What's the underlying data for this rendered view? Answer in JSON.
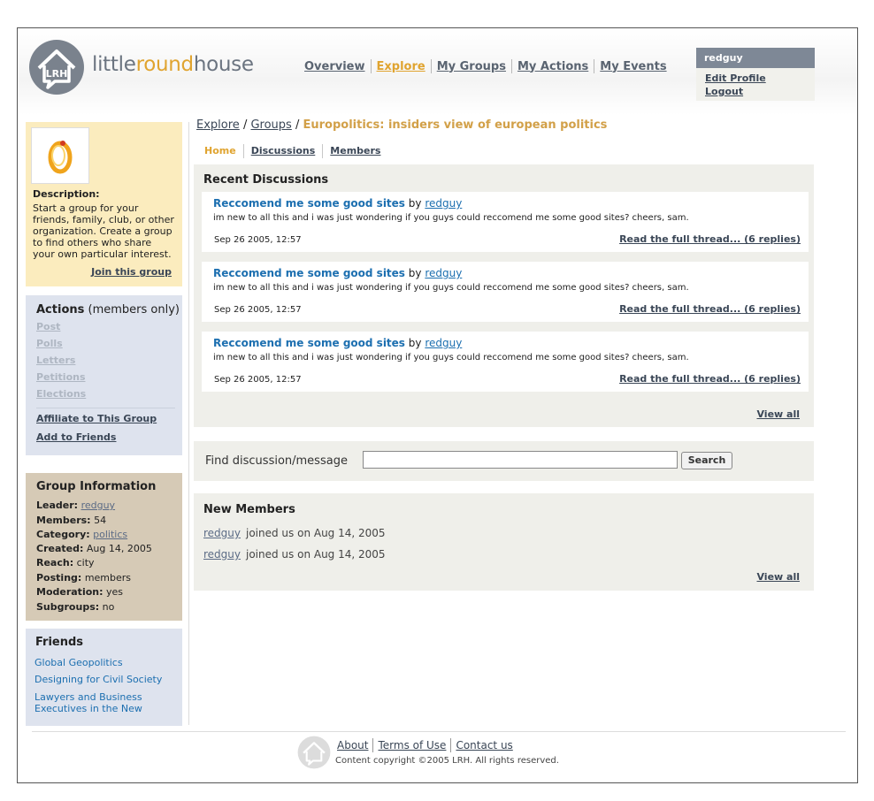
{
  "header": {
    "logo_icon_text": "LRH",
    "logo_part1": "little",
    "logo_part2": "round",
    "logo_part3": "house",
    "nav": [
      {
        "label": "Overview"
      },
      {
        "label": "Explore"
      },
      {
        "label": "My Groups"
      },
      {
        "label": "My Actions"
      },
      {
        "label": "My Events"
      }
    ],
    "user": {
      "name": "redguy",
      "edit_profile": "Edit Profile",
      "logout": "Logout"
    }
  },
  "sidebar": {
    "description_label": "Description:",
    "description_text": "Start a group for your friends, family, club, or other organization. Create a group to find others who share your own particular interest.",
    "join_link": "Join this group",
    "actions": {
      "title": "Actions",
      "subtitle": "(members only)",
      "items": [
        "Post",
        "Polls",
        "Letters",
        "Petitions",
        "Elections"
      ],
      "affiliate": "Affiliate to This Group",
      "add_friends": "Add to Friends"
    },
    "group_info": {
      "title": "Group Information",
      "leader_label": "Leader:",
      "leader": "redguy",
      "members_label": "Members:",
      "members": "54",
      "category_label": "Category:",
      "category": "politics",
      "created_label": "Created:",
      "created": "Aug 14, 2005",
      "reach_label": "Reach:",
      "reach": "city",
      "posting_label": "Posting:",
      "posting": "members",
      "moderation_label": "Moderation:",
      "moderation": "yes",
      "subgroups_label": "Subgroups:",
      "subgroups": "no"
    },
    "friends": {
      "title": "Friends",
      "items": [
        "Global Geopolitics",
        "Designing for Civil Society",
        "Lawyers and Business Executives in the New"
      ]
    }
  },
  "main": {
    "breadcrumb": {
      "explore": "Explore",
      "sep": "/",
      "groups": "Groups",
      "current": "Europolitics: insiders view of european politics"
    },
    "tabs": [
      {
        "label": "Home"
      },
      {
        "label": "Discussions"
      },
      {
        "label": "Members"
      }
    ],
    "recent": {
      "title": "Recent Discussions",
      "posts": [
        {
          "title": "Reccomend me some good sites",
          "by": "by",
          "user": "redguy",
          "body": "im new to all this and i was just wondering if you guys could reccomend me some good sites? cheers, sam.",
          "date": "Sep 26 2005, 12:57",
          "read": "Read the full thread... (6 replies)"
        },
        {
          "title": "Reccomend me some good sites",
          "by": "by",
          "user": "redguy",
          "body": "im new to all this and i was just wondering if you guys could reccomend me some good sites? cheers, sam.",
          "date": "Sep 26 2005, 12:57",
          "read": "Read the full thread... (6 replies)"
        },
        {
          "title": "Reccomend me some good sites",
          "by": "by",
          "user": "redguy",
          "body": "im new to all this and i was just wondering if you guys could reccomend me some good sites? cheers, sam.",
          "date": "Sep 26 2005, 12:57",
          "read": "Read the full thread... (6 replies)"
        }
      ],
      "view_all": "View all"
    },
    "find": {
      "label": "Find discussion/message",
      "value": "",
      "button": "Search"
    },
    "new_members": {
      "title": "New Members",
      "rows": [
        {
          "user": "redguy",
          "text": "joined us on Aug 14, 2005"
        },
        {
          "user": "redguy",
          "text": "joined us on Aug 14, 2005"
        }
      ],
      "view_all": "View all"
    }
  },
  "footer": {
    "links": [
      "About",
      "Terms of Use",
      "Contact us"
    ],
    "copyright": "Content copyright ©2005 LRH. All rights reserved."
  }
}
